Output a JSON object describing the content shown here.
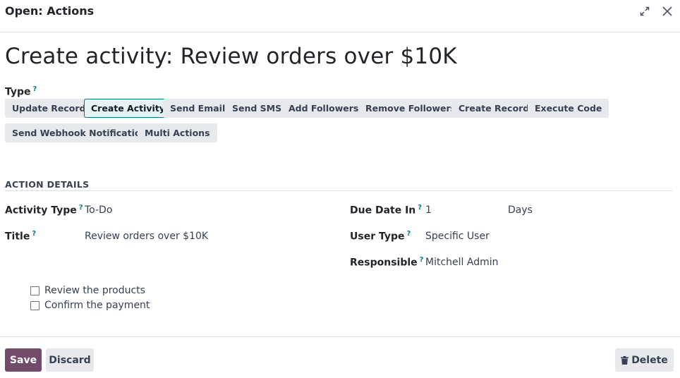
{
  "dialog": {
    "title": "Open: Actions",
    "expand_icon": "expand-icon",
    "close_icon": "close-icon"
  },
  "record": {
    "title": "Create activity: Review orders over $10K"
  },
  "type": {
    "label": "Type",
    "help": "?",
    "options": [
      {
        "label": "Update Record",
        "active": false
      },
      {
        "label": "Create Activity",
        "active": true
      },
      {
        "label": "Send Email",
        "active": false
      },
      {
        "label": "Send SMS",
        "active": false
      },
      {
        "label": "Add Followers",
        "active": false
      },
      {
        "label": "Remove Followers",
        "active": false
      },
      {
        "label": "Create Record",
        "active": false
      },
      {
        "label": "Execute Code",
        "active": false
      },
      {
        "label": "Send Webhook Notification",
        "active": false
      },
      {
        "label": "Multi Actions",
        "active": false
      }
    ]
  },
  "section": {
    "title": "ACTION DETAILS"
  },
  "fields": {
    "activity_type": {
      "label": "Activity Type",
      "help": "?",
      "value": "To-Do"
    },
    "title": {
      "label": "Title",
      "help": "?",
      "value": "Review orders over $10K"
    },
    "due_date": {
      "label": "Due Date In",
      "help": "?",
      "value": "1",
      "unit": "Days"
    },
    "user_type": {
      "label": "User Type",
      "help": "?",
      "value": "Specific User"
    },
    "responsible": {
      "label": "Responsible",
      "help": "?",
      "value": "Mitchell Admin"
    }
  },
  "checklist": [
    {
      "label": "Review the products",
      "checked": false
    },
    {
      "label": "Confirm the payment",
      "checked": false
    }
  ],
  "footer": {
    "save_label": "Save",
    "discard_label": "Discard",
    "delete_label": "Delete",
    "delete_icon": "trash-icon"
  },
  "colors": {
    "primary": "#714b67",
    "accent": "#017e84",
    "button_bg": "#e7e9ed"
  }
}
